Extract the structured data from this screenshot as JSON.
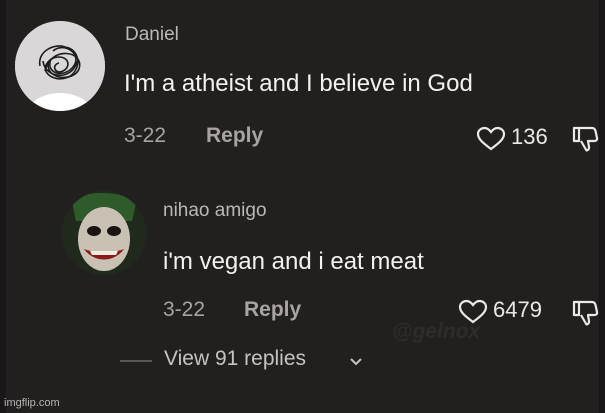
{
  "comments": [
    {
      "username": "Daniel",
      "text": "I'm a atheist and I believe in God",
      "date": "3-22",
      "reply_label": "Reply",
      "likes": "136"
    },
    {
      "username": "nihao amigo",
      "text": "i'm vegan and i eat meat",
      "date": "3-22",
      "reply_label": "Reply",
      "likes": "6479"
    }
  ],
  "view_replies": "View 91 replies",
  "watermark": "@gelnox",
  "footer": "imgflip.com",
  "icons": {
    "like": "heart-icon",
    "dislike": "thumbs-down-icon",
    "expand": "chevron-down-icon"
  }
}
